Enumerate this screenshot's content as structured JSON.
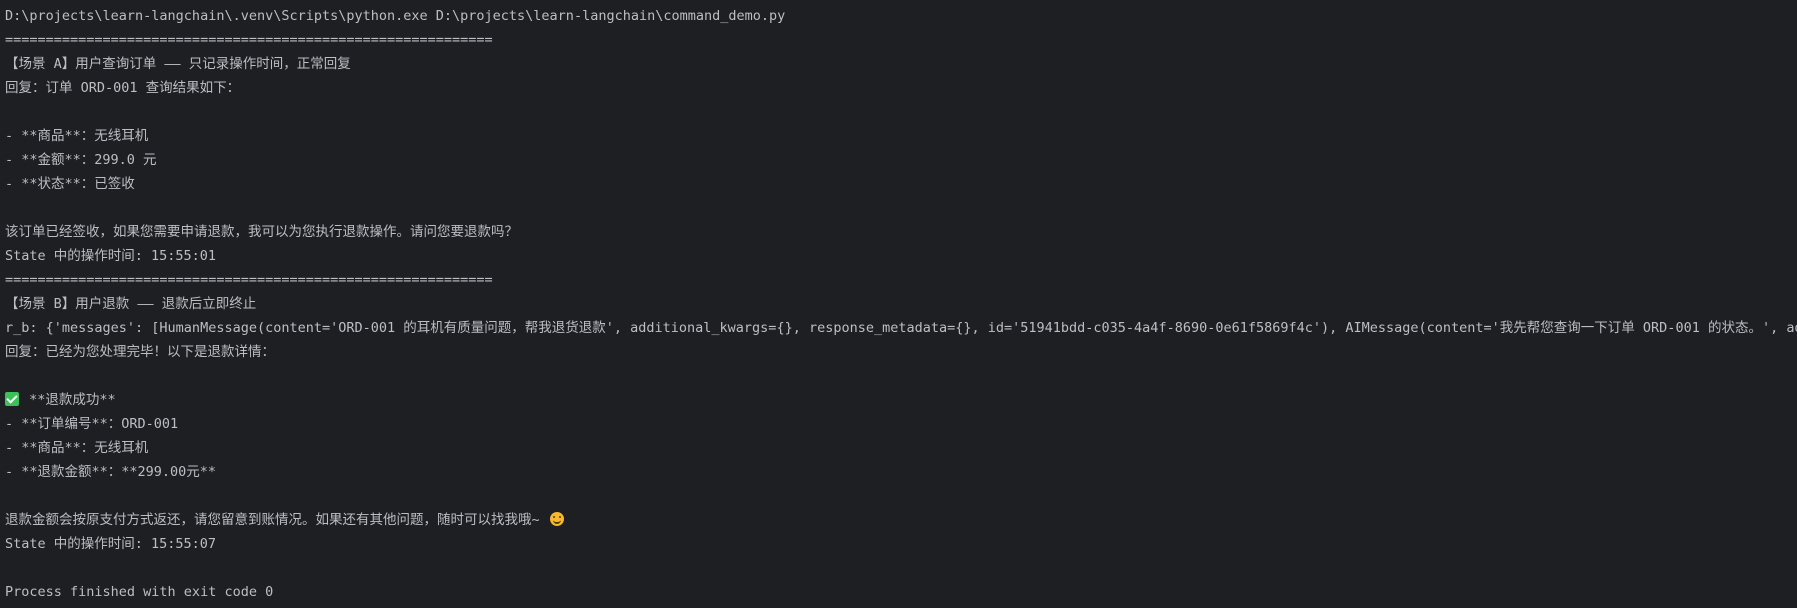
{
  "console": {
    "lines": [
      "D:\\projects\\learn-langchain\\.venv\\Scripts\\python.exe D:\\projects\\learn-langchain\\command_demo.py",
      "============================================================",
      "【场景 A】用户查询订单 —— 只记录操作时间，正常回复",
      "回复：订单 ORD-001 查询结果如下：",
      "",
      "- **商品**：无线耳机",
      "- **金额**：299.0 元",
      "- **状态**：已签收",
      "",
      "该订单已经签收，如果您需要申请退款，我可以为您执行退款操作。请问您要退款吗？",
      "State 中的操作时间: 15:55:01",
      "============================================================",
      "【场景 B】用户退款 —— 退款后立即终止",
      "r_b: {'messages': [HumanMessage(content='ORD-001 的耳机有质量问题，帮我退货退款', additional_kwargs={}, response_metadata={}, id='51941bdd-c035-4a4f-8690-0e61f5869f4c'), AIMessage(content='我先帮您查询一下订单 ORD-001 的状态。', ad",
      "回复：已经为您处理完毕！以下是退款详情：",
      "",
      " **退款成功**",
      "- **订单编号**：ORD-001",
      "- **商品**：无线耳机",
      "- **退款金额**：**299.00元**",
      "",
      "退款金额会按原支付方式返还，请您留意到账情况。如果还有其他问题，随时可以找我哦~ ",
      "State 中的操作时间: 15:55:07",
      "",
      "Process finished with exit code 0"
    ],
    "icons": {
      "success": "check-mark-icon",
      "smile": "smiling-face-icon"
    },
    "colors": {
      "background": "#1e1f22",
      "text": "#bcbec4",
      "check": "#3dbf59",
      "smile": "#f5b82e"
    }
  }
}
